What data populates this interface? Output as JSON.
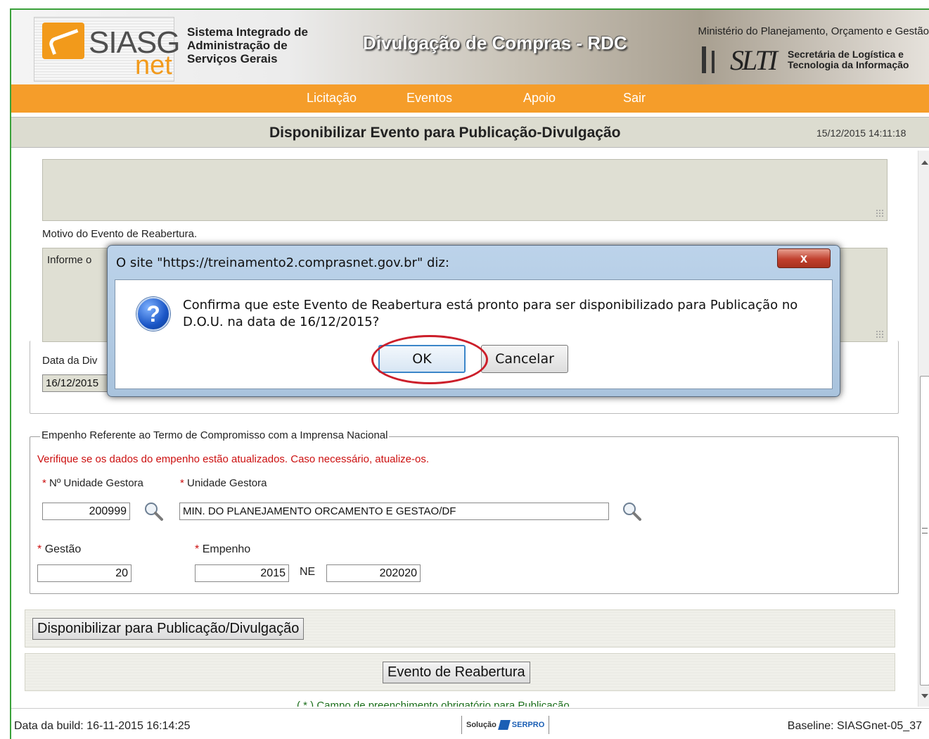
{
  "header": {
    "logo_siasg": "SIASG",
    "logo_net": "net",
    "system_name": "Sistema Integrado de Administração de Serviços Gerais",
    "app_title": "Divulgação de Compras - RDC",
    "ministry": "Ministério do Planejamento, Orçamento e Gestão",
    "slti": "SLTI",
    "slti_desc": "Secretária de Logística e Tecnologia da Informação"
  },
  "nav": {
    "items": [
      {
        "label": "Licitação"
      },
      {
        "label": "Eventos"
      },
      {
        "label": "Apoio"
      },
      {
        "label": "Sair"
      }
    ]
  },
  "titlebar": {
    "title": "Disponibilizar Evento para Publicação-Divulgação",
    "datetime": "15/12/2015 14:11:18"
  },
  "form": {
    "motivo_label": "Motivo do Evento de Reabertura.",
    "motivo_placeholder": "Informe o",
    "data_label": "Data da Div",
    "data_value": "16/12/2015",
    "empenho_legend": "Empenho Referente ao Termo de Compromisso com a Imprensa Nacional",
    "empenho_warning": "Verifique se os dados do empenho estão atualizados. Caso necessário, atualize-os.",
    "required_mark": "*",
    "ug_number_label": "Nº Unidade Gestora",
    "ug_label": "Unidade Gestora",
    "ug_number_value": "200999",
    "ug_value": "MIN. DO PLANEJAMENTO ORCAMENTO E GESTAO/DF",
    "gestao_label": "Gestão",
    "gestao_value": "20",
    "empenho_label": "Empenho",
    "empenho_year": "2015",
    "ne_label": "NE",
    "empenho_number": "202020",
    "disponibilizar_button": "Disponibilizar para Publicação/Divulgação",
    "evento_button": "Evento de Reabertura",
    "required_note": "( * ) Campo de preenchimento obrigatório para Publicação."
  },
  "footer": {
    "build": "Data da build: 16-11-2015 16:14:25",
    "solucao": "Solução",
    "serpro": "SERPRO",
    "baseline": "Baseline: SIASGnet-05_37"
  },
  "dialog": {
    "title": "O site \"https://treinamento2.comprasnet.gov.br\" diz:",
    "close": "x",
    "message": "Confirma que este Evento de Reabertura está pronto para ser disponibilizado para Publicação no D.O.U. na data de 16/12/2015?",
    "icon_glyph": "?",
    "ok": "OK",
    "cancel": "Cancelar"
  }
}
